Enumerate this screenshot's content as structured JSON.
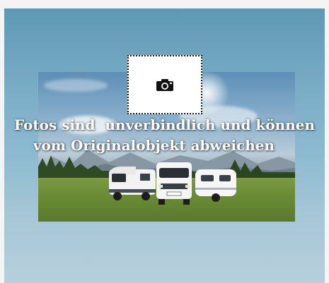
{
  "placeholder": {
    "disclaimer_line1": "Fotos sind  unverbindlich und können",
    "disclaimer_line2": "vom Originalobjekt abweichen",
    "icon": "camera-icon"
  },
  "colors": {
    "background_top": "#5f98b4",
    "background_bottom": "#b7cfdc",
    "frame": "#f4f4f4",
    "text": "#ffffff"
  }
}
